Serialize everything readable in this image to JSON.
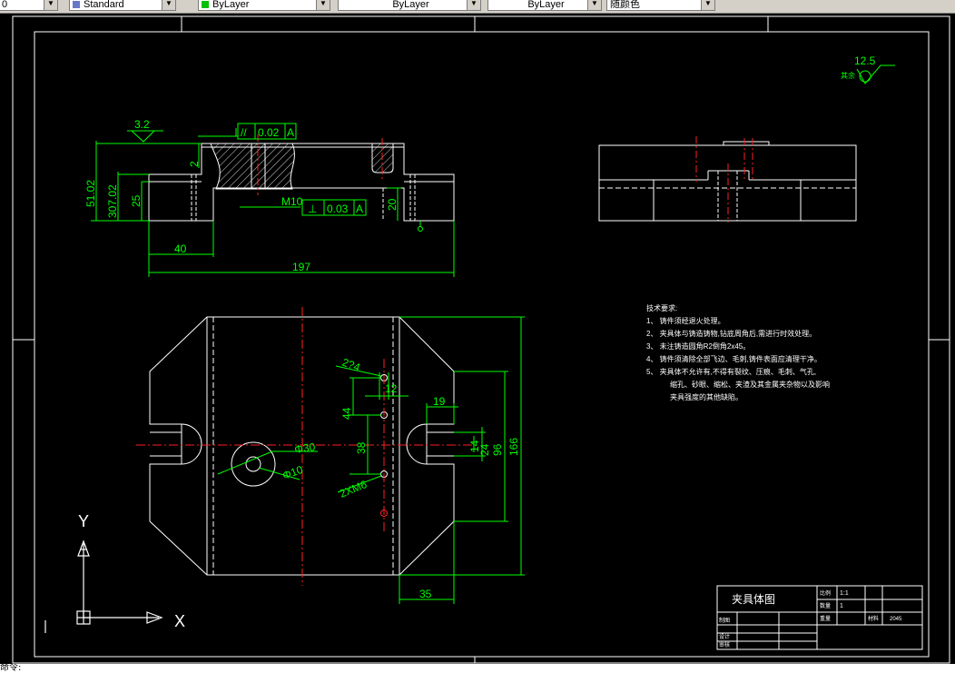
{
  "toolbar": {
    "style_select": "Standard",
    "layer_select": "ByLayer",
    "linetype_select": "ByLayer",
    "lineweight_select": "ByLayer",
    "color_select": "随颜色",
    "layer_swatch_color": "#00c000"
  },
  "drawing": {
    "dims_front": {
      "roughness": "3.2",
      "parallelism_symbol": "//",
      "parallelism_value": "0.02",
      "parallelism_datum": "A",
      "dim_2": "2",
      "dim_total_height": "51.02",
      "dim_307": "307.02",
      "dim_25": "25",
      "dim_40": "40",
      "dim_197": "197",
      "m10": "M10",
      "perp_symbol": "⊥",
      "perp_value": "0.03",
      "perp_datum": "A",
      "dim_20": "20"
    },
    "dims_top": {
      "dim_2x4": "2?4",
      "dim_12": "12",
      "dim_19": "19",
      "dim_44": "44",
      "dim_38": "38",
      "dim_phi30": "Φ30",
      "dim_phi10": "Φ10",
      "dim_2xm6": "2XM6",
      "dim_14": "14",
      "dim_24": "24",
      "dim_96": "96",
      "dim_166": "166",
      "dim_35": "35"
    },
    "surface_roughness": {
      "value": "12.5",
      "label": "其余"
    },
    "tech_requirements": {
      "title": "技术要求:",
      "items": [
        "1、 铸件须经退火处理。",
        "2、 夹具体与铸造铸物,钻底周角后,需进行时效处理。",
        "3、 未注铸造圆角R2倒角2x45。",
        "4、 铸件须清除全部飞边、毛刺,铸件表面应清理干净。",
        "5、 夹具体不允许有,不得有裂纹、压痕、毛刺、气孔,",
        "缩孔、砂眼、缩松、夹渣及其金属夹杂物以及影响",
        "夹具强度的其他缺陷。"
      ]
    },
    "title_block": {
      "name": "夹具体图",
      "ratio_label": "比例",
      "ratio_value": "1:1",
      "qty_label": "数量",
      "qty_value": "1",
      "weight_label": "重量",
      "material_label": "材料",
      "material_value": "2045",
      "drawn_label": "制图",
      "design_label": "设计",
      "check_label": "审核"
    },
    "ucs": {
      "x_label": "X",
      "y_label": "Y"
    }
  },
  "status": {
    "command_text": "命令:"
  },
  "colors": {
    "geometry": "#ffffff",
    "dimension": "#00ff00",
    "centerline": "#ff2020",
    "hatch": "#ffffff"
  }
}
